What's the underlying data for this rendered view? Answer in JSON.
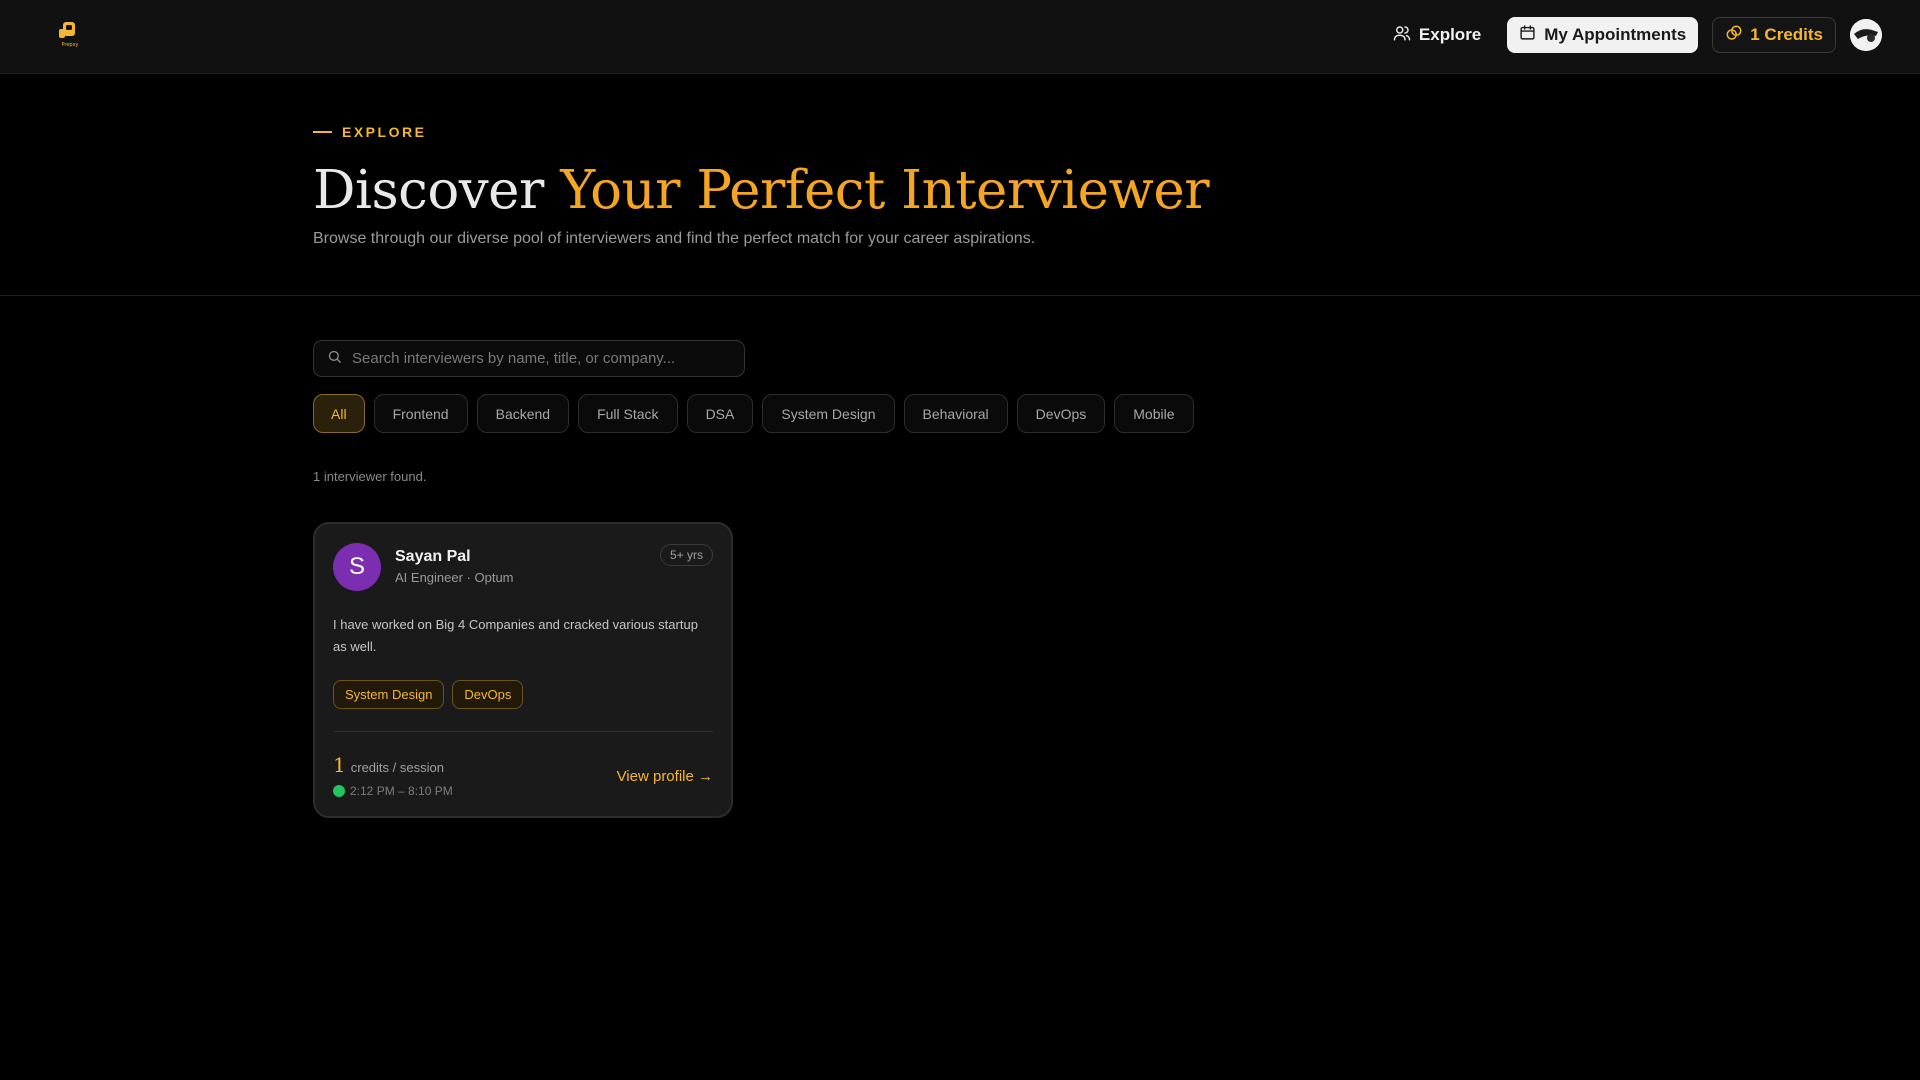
{
  "nav": {
    "logo_text": "Prepxy",
    "explore_label": "Explore",
    "appointments_label": "My Appointments",
    "credits_label": "1 Credits"
  },
  "hero": {
    "eyebrow": "EXPLORE",
    "title_part1": "Discover ",
    "title_part2": "Your Perfect Interviewer",
    "subtitle": "Browse through our diverse pool of interviewers and find the perfect match for your career aspirations."
  },
  "search": {
    "placeholder": "Search interviewers by name, title, or company..."
  },
  "filters": {
    "active": "All",
    "chips": [
      "All",
      "Frontend",
      "Backend",
      "Full Stack",
      "DSA",
      "System Design",
      "Behavioral",
      "DevOps",
      "Mobile"
    ]
  },
  "results": {
    "count_text": "1 interviewer found."
  },
  "interviewers": [
    {
      "initial": "S",
      "name": "Sayan Pal",
      "role": "AI Engineer · Optum",
      "experience": "5+ yrs",
      "bio": "I have worked on Big 4 Companies and cracked various startup as well.",
      "tags": [
        "System Design",
        "DevOps"
      ],
      "credits": "1",
      "credits_unit": "credits / session",
      "availability": "2:12 PM – 8:10 PM",
      "view_label": "View profile →"
    }
  ],
  "colors": {
    "accent": "#f5b731",
    "avatar_bg": "#7b2fb0",
    "available": "#22c55e",
    "background": "#000000"
  }
}
